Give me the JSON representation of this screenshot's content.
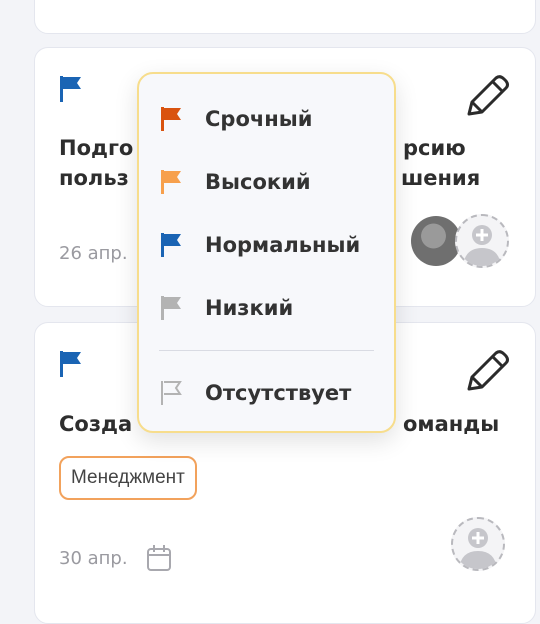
{
  "cards": [
    {
      "title_left_1": "Подго",
      "title_left_2": "польз",
      "title_right_1": "рсию",
      "title_right_2": "шения",
      "date": "26 апр.",
      "flag_color": "#1a64b4"
    },
    {
      "title_left": "Созда",
      "title_right": "оманды",
      "tag": "Менеджмент",
      "date": "30 апр.",
      "flag_color": "#1a64b4"
    }
  ],
  "priority_menu": {
    "items": [
      {
        "label": "Срочный",
        "color": "#d9530f",
        "icon": "flag-filled-icon"
      },
      {
        "label": "Высокий",
        "color": "#f7a04c",
        "icon": "flag-filled-icon"
      },
      {
        "label": "Нормальный",
        "color": "#1a64b4",
        "icon": "flag-filled-icon"
      },
      {
        "label": "Низкий",
        "color": "#b3b3b3",
        "icon": "flag-filled-icon"
      },
      {
        "label": "Отсутствует",
        "color": "#b3b3b3",
        "icon": "flag-outline-icon"
      }
    ]
  }
}
